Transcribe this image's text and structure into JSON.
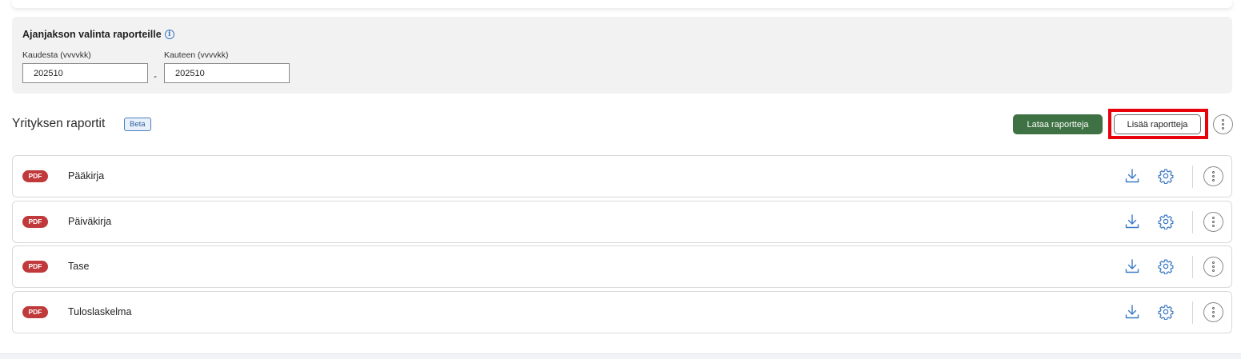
{
  "period": {
    "title": "Ajanjakson valinta raporteille",
    "info_icon": "info-icon",
    "from_label": "Kaudesta (vvvvkk)",
    "from_value": "202510",
    "separator": "-",
    "to_label": "Kauteen (vvvvkk)",
    "to_value": "202510"
  },
  "reports_section": {
    "title": "Yrityksen raportit",
    "badge": "Beta",
    "download_button": "Lataa raportteja",
    "add_button": "Lisää raportteja",
    "more_icon": "more-vertical-icon"
  },
  "reports": [
    {
      "format": "PDF",
      "name": "Pääkirja"
    },
    {
      "format": "PDF",
      "name": "Päiväkirja"
    },
    {
      "format": "PDF",
      "name": "Tase"
    },
    {
      "format": "PDF",
      "name": "Tuloslaskelma"
    }
  ],
  "colors": {
    "primary_green": "#3e7143",
    "pdf_red": "#c0393b",
    "icon_blue": "#3a79c4",
    "highlight_red": "#e8000b"
  }
}
